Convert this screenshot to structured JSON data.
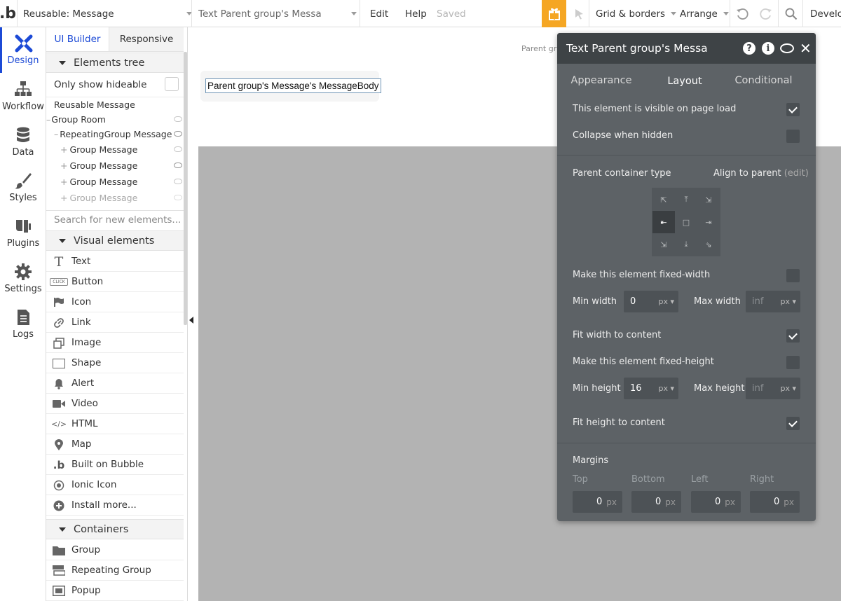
{
  "topbar": {
    "page_selector": "Reusable: Message",
    "element_selector": "Text Parent group's Messa",
    "edit": "Edit",
    "help": "Help",
    "saved": "Saved",
    "grid": "Grid & borders",
    "arrange": "Arrange",
    "develop": "Develop"
  },
  "leftnav": [
    {
      "label": "Design",
      "icon": "design-icon"
    },
    {
      "label": "Workflow",
      "icon": "workflow-icon"
    },
    {
      "label": "Data",
      "icon": "data-icon"
    },
    {
      "label": "Styles",
      "icon": "styles-icon"
    },
    {
      "label": "Plugins",
      "icon": "plugins-icon"
    },
    {
      "label": "Settings",
      "icon": "settings-icon"
    },
    {
      "label": "Logs",
      "icon": "logs-icon"
    }
  ],
  "panel": {
    "tab_ui": "UI Builder",
    "tab_responsive": "Responsive",
    "elements_tree": "Elements tree",
    "only_hideable": "Only show hideable",
    "tree": [
      "Reusable Message",
      "Group Room",
      "RepeatingGroup Message",
      "Group Message",
      "Group Message",
      "Group Message",
      "Group Message"
    ],
    "search_placeholder": "Search for new elements...",
    "visual_elements": "Visual elements",
    "visual": [
      "Text",
      "Button",
      "Icon",
      "Link",
      "Image",
      "Shape",
      "Alert",
      "Video",
      "HTML",
      "Map",
      "Built on Bubble",
      "Ionic Icon",
      "Install more..."
    ],
    "button_icon_text": "CLICK",
    "containers": "Containers",
    "container_items": [
      "Group",
      "Repeating Group",
      "Popup"
    ]
  },
  "canvas": {
    "page_label": "Parent gr",
    "text_element": "Parent group's Message's MessageBody"
  },
  "editor": {
    "title": "Text Parent group's Messa",
    "tabs": [
      "Appearance",
      "Layout",
      "Conditional"
    ],
    "active_tab": "Layout",
    "visible_on_load": "This element is visible on page load",
    "collapse_hidden": "Collapse when hidden",
    "parent_container_type": "Parent container type",
    "align_to_parent": "Align to parent",
    "edit_link": "(edit)",
    "fixed_width": "Make this element fixed-width",
    "min_width": "Min width",
    "min_width_val": "0",
    "max_width": "Max width",
    "max_width_val": "inf",
    "fit_width": "Fit width to content",
    "fixed_height": "Make this element fixed-height",
    "min_height": "Min height",
    "min_height_val": "16",
    "max_height": "Max height",
    "max_height_val": "inf",
    "fit_height": "Fit height to content",
    "unit": "px",
    "margins": "Margins",
    "margin_labels": [
      "Top",
      "Bottom",
      "Left",
      "Right"
    ],
    "margin_vals": [
      "0",
      "0",
      "0",
      "0"
    ],
    "accent": "#1c4ad6",
    "gift_color": "#f5a623"
  }
}
